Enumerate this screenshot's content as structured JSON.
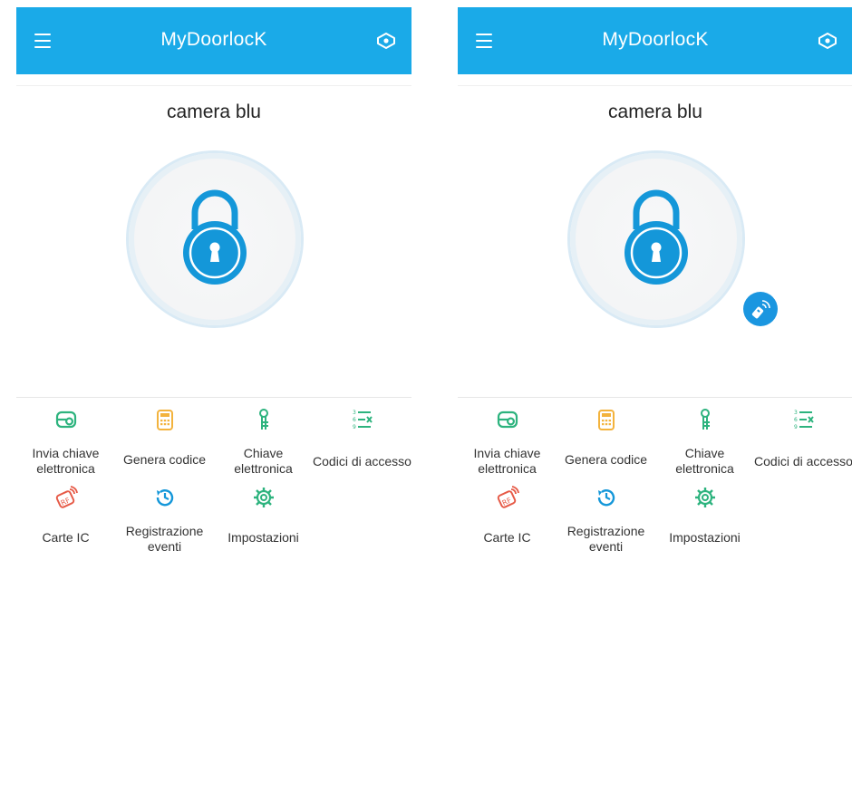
{
  "colors": {
    "accent": "#1aaae8",
    "lock_blue": "#1497d9",
    "remote_blue": "#1a96e0",
    "green": "#2db37e",
    "orange": "#f3b33d",
    "red": "#e65a47"
  },
  "screens": [
    {
      "header": {
        "title": "MyDoorlocK",
        "menu_icon": "hamburger-icon",
        "scan_icon": "eye-scan-icon"
      },
      "lock_name": "camera blu",
      "lock_button": {
        "icon": "padlock-icon"
      },
      "remote_indicator": false,
      "menu": [
        {
          "label": "Invia chiave elettronica",
          "icon": "send-ekey-icon"
        },
        {
          "label": "Genera codice",
          "icon": "keypad-code-icon"
        },
        {
          "label": "Chiave elettronica",
          "icon": "ekeys-icon"
        },
        {
          "label": "Codici di accesso",
          "icon": "passcodes-icon"
        },
        {
          "label": "Carte IC",
          "icon": "ic-card-icon"
        },
        {
          "label": "Registrazione eventi",
          "icon": "history-icon"
        },
        {
          "label": "Impostazioni",
          "icon": "settings-gear-icon"
        }
      ]
    },
    {
      "header": {
        "title": "MyDoorlocK",
        "menu_icon": "hamburger-icon",
        "scan_icon": "eye-scan-icon"
      },
      "lock_name": "camera blu",
      "lock_button": {
        "icon": "padlock-icon"
      },
      "remote_indicator": true,
      "remote_icon": "remote-control-icon",
      "menu": [
        {
          "label": "Invia chiave elettronica",
          "icon": "send-ekey-icon"
        },
        {
          "label": "Genera codice",
          "icon": "keypad-code-icon"
        },
        {
          "label": "Chiave elettronica",
          "icon": "ekeys-icon"
        },
        {
          "label": "Codici di accesso",
          "icon": "passcodes-icon"
        },
        {
          "label": "Carte IC",
          "icon": "ic-card-icon"
        },
        {
          "label": "Registrazione eventi",
          "icon": "history-icon"
        },
        {
          "label": "Impostazioni",
          "icon": "settings-gear-icon"
        }
      ]
    }
  ]
}
